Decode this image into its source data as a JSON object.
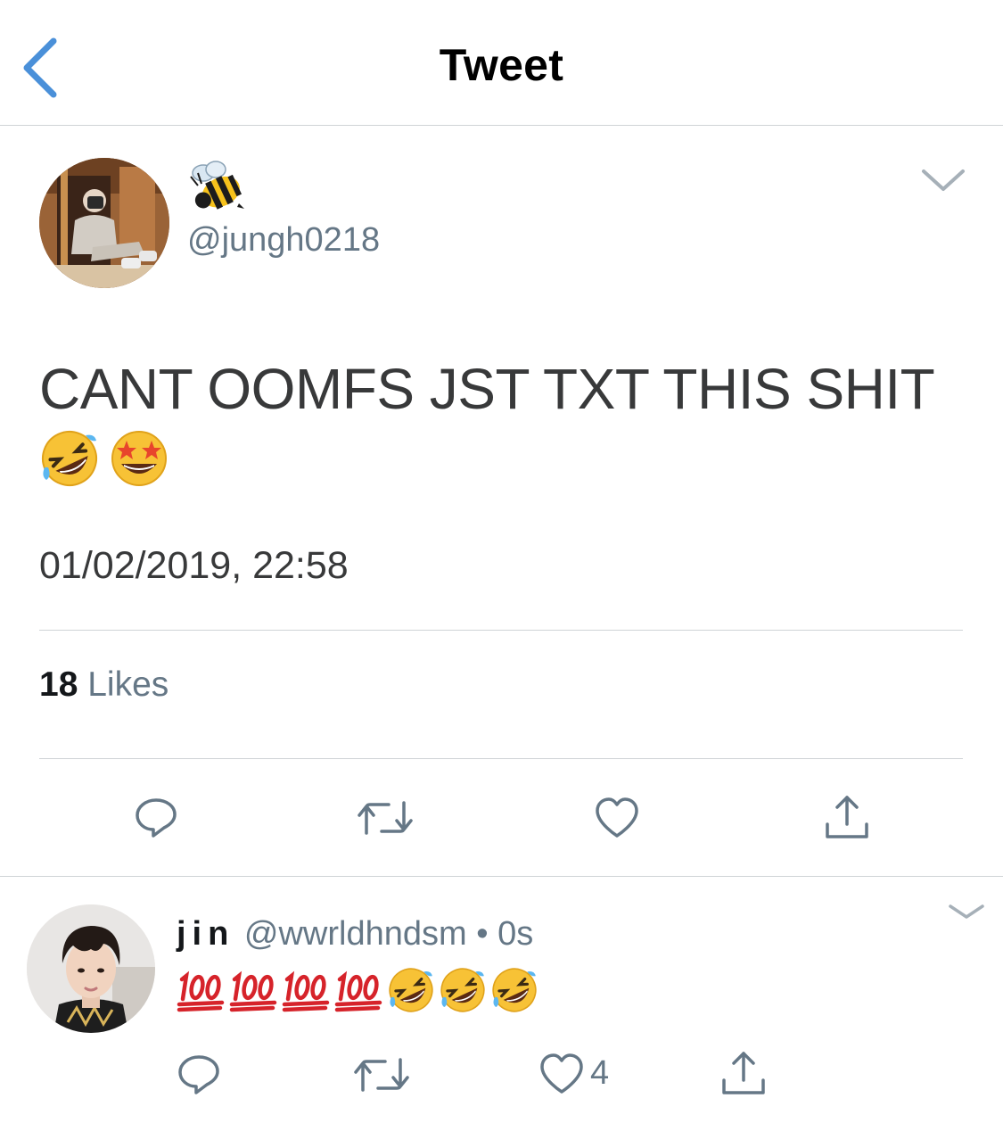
{
  "header": {
    "title": "Tweet"
  },
  "tweet": {
    "name_emoji": "🐝",
    "handle": "@jungh0218",
    "text": "CANT OOMFS JST TXT THIS SHIT",
    "emojis": [
      "🤣",
      "🤩"
    ],
    "timestamp": "01/02/2019, 22:58",
    "likes_count": "18",
    "likes_label": "Likes"
  },
  "reply": {
    "name": "jin",
    "handle": "@wwrldhndsm",
    "separator": "•",
    "time": "0s",
    "emojis": [
      "💯",
      "💯",
      "💯",
      "💯",
      "🤣",
      "🤣",
      "🤣"
    ],
    "like_count": "4"
  },
  "colors": {
    "accent": "#4a90d9",
    "icon_gray": "#657786",
    "divider": "#cfd3d6"
  },
  "icons": {
    "back": "chevron-left-icon",
    "menu": "chevron-down-icon",
    "reply": "comment-icon",
    "retweet": "retweet-icon",
    "like": "heart-icon",
    "share": "share-icon"
  }
}
